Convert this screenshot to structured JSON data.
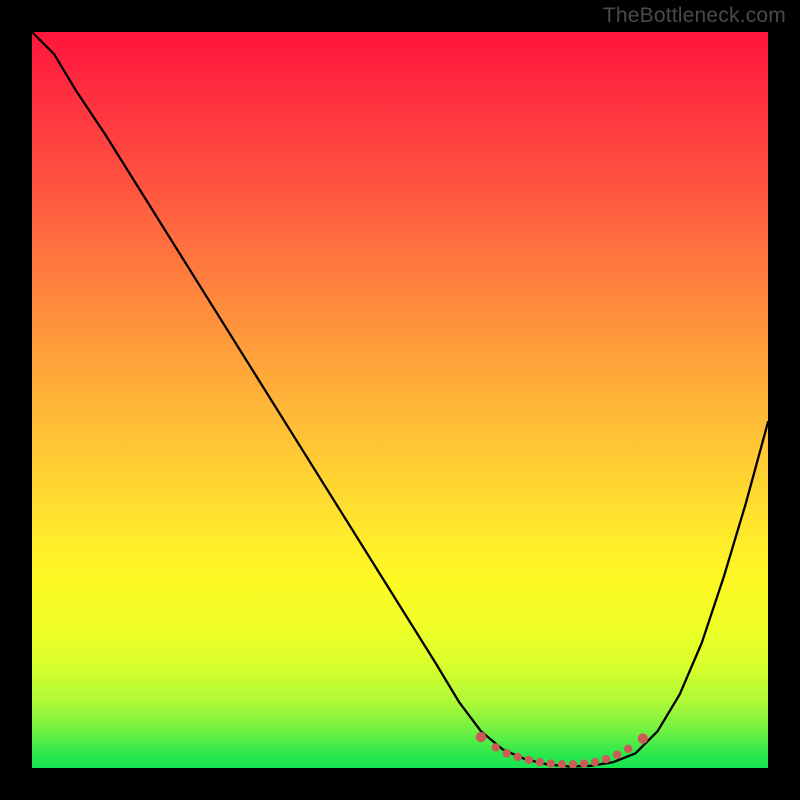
{
  "watermark": "TheBottleneck.com",
  "colors": {
    "frame": "#000000",
    "curve": "#000000",
    "dots": "#cc5a56",
    "watermark": "#4a4a4a"
  },
  "chart_data": {
    "type": "line",
    "title": "",
    "xlabel": "",
    "ylabel": "",
    "xlim": [
      0,
      100
    ],
    "ylim": [
      0,
      100
    ],
    "grid": false,
    "series": [
      {
        "name": "bottleneck-curve",
        "x": [
          0,
          3,
          6,
          10,
          15,
          20,
          25,
          30,
          35,
          40,
          45,
          50,
          55,
          58,
          61,
          64,
          67,
          70,
          73,
          76,
          79,
          82,
          85,
          88,
          91,
          94,
          97,
          100
        ],
        "y": [
          100,
          97,
          92,
          86,
          78,
          70,
          62,
          54,
          46,
          38,
          30,
          22,
          14,
          9,
          5,
          2.5,
          1.2,
          0.5,
          0.2,
          0.3,
          0.8,
          2,
          5,
          10,
          17,
          26,
          36,
          47
        ]
      }
    ],
    "dots": {
      "name": "highlighted-range",
      "x": [
        61,
        63,
        64.5,
        66,
        67.5,
        69,
        70.5,
        72,
        73.5,
        75,
        76.5,
        78,
        79.5,
        81,
        83
      ],
      "y": [
        4.2,
        2.8,
        2.0,
        1.5,
        1.1,
        0.8,
        0.6,
        0.5,
        0.5,
        0.6,
        0.8,
        1.2,
        1.8,
        2.6,
        4.0
      ]
    },
    "gradient_stops": [
      {
        "offset": 0,
        "color": "#ff153b"
      },
      {
        "offset": 50,
        "color": "#ffb037"
      },
      {
        "offset": 75,
        "color": "#fff825"
      },
      {
        "offset": 100,
        "color": "#17e351"
      }
    ]
  }
}
